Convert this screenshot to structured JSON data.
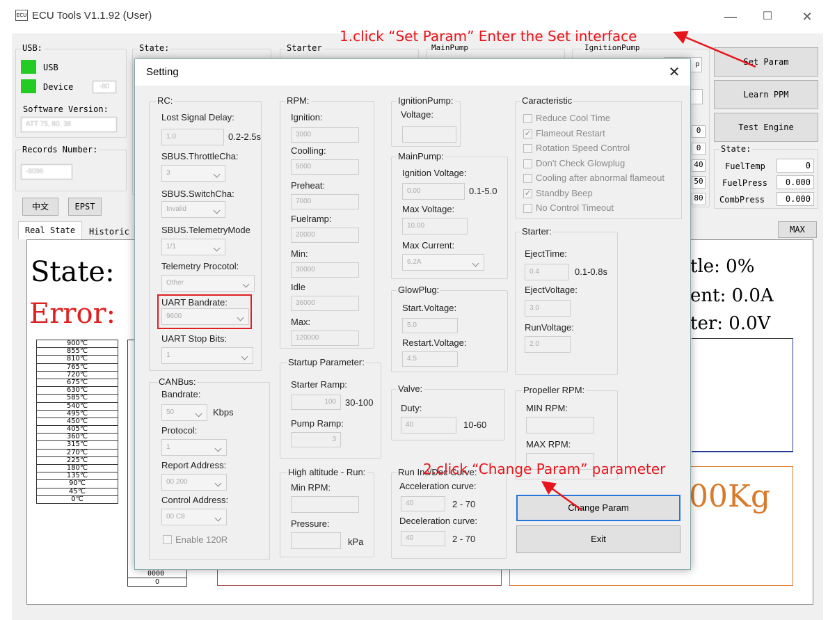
{
  "window": {
    "title": "ECU Tools V1.1.92 (User)",
    "icon": "ECU",
    "minimize": "—",
    "maximize": "☐",
    "close": "✕"
  },
  "main": {
    "usb_group": "USB:",
    "usb_label": "USB",
    "device_label": "Device",
    "device_value": "-80",
    "software_version_label": "Software Version:",
    "software_version_value": "ATT 75, 80. 38",
    "records_label": "Records Number:",
    "records_value": "-8096",
    "state_group": "State:",
    "starter_group": "Starter",
    "mainpump_group": "MainPump",
    "ignitionpump_group": "IgnitionPump",
    "lang_button": "中文",
    "epst_button": "EPST",
    "set_param": "Set Param",
    "learn_ppm": "Learn PPM",
    "test_engine": "Test Engine",
    "state_side": {
      "label": "State:",
      "rows": [
        {
          "name": "FuelTemp",
          "value": "0"
        },
        {
          "name": "FuelPress",
          "value": "0.000"
        },
        {
          "name": "CombPress",
          "value": "0.000"
        }
      ]
    },
    "tab_real": "Real State",
    "tab_historic": "Historic r",
    "max_button": "MAX",
    "state_text": "State:",
    "error_text": "Error:",
    "temps": [
      "900℃",
      "855℃",
      "810℃",
      "765℃",
      "720℃",
      "675℃",
      "630℃",
      "585℃",
      "540℃",
      "495℃",
      "450℃",
      "405℃",
      "360℃",
      "315℃",
      "270℃",
      "225℃",
      "180℃",
      "135℃",
      "90℃",
      "45℃",
      "0℃"
    ],
    "col2_values": [
      "0000",
      "0"
    ],
    "right_readouts": [
      "tle: 0%",
      "ent: 0.0A",
      "ter: 0.0V"
    ],
    "kg_text": "00Kg",
    "mini_values": [
      "0",
      "0",
      "40",
      "50",
      "80"
    ],
    "side_labels": [
      "p"
    ]
  },
  "dialog": {
    "title": "Setting",
    "close": "✕",
    "rc": {
      "group": "RC:",
      "lost_signal_delay": "Lost Signal Delay:",
      "lost_signal_value": "1.0",
      "lost_signal_range": "0.2-2.5s",
      "sbus_throttle": "SBUS.ThrottleCha:",
      "sbus_throttle_value": "3",
      "sbus_switch": "SBUS.SwitchCha:",
      "sbus_switch_value": "Invalid",
      "sbus_telemetry": "SBUS.TelemetryMode",
      "sbus_telemetry_value": "1/1",
      "telemetry_protocol": "Telemetry Procotol:",
      "telemetry_protocol_value": "Other",
      "uart_bandrate": "UART Bandrate:",
      "uart_bandrate_value": "9600",
      "uart_stop": "UART Stop Bits:",
      "uart_stop_value": "1"
    },
    "canbus": {
      "group": "CANBus:",
      "bandrate": "Bandrate:",
      "bandrate_value": "50",
      "kbps": "Kbps",
      "protocol": "Protocol:",
      "protocol_value": "1",
      "report_address": "Report Address:",
      "report_value": "00 200",
      "control_address": "Control Address:",
      "control_value": "00 C8",
      "enable120r": "Enable 120R"
    },
    "rpm": {
      "group": "RPM:",
      "ignition": "Ignition:",
      "ignition_value": "3000",
      "coolling": "Coolling:",
      "coolling_value": "5000",
      "preheat": "Preheat:",
      "preheat_value": "7000",
      "fuelramp": "Fuelramp:",
      "fuelramp_value": "20000",
      "min": "Min:",
      "min_value": "30000",
      "idle": "Idle",
      "idle_value": "36000",
      "max": "Max:",
      "max_value": "120000"
    },
    "startup": {
      "group": "Startup Parameter:",
      "starter_ramp": "Starter Ramp:",
      "starter_ramp_value": "100",
      "starter_ramp_range": "30-100",
      "pump_ramp": "Pump Ramp:",
      "pump_ramp_value": "3"
    },
    "altitude": {
      "group": "High altitude - Run:",
      "min_rpm": "Min RPM:",
      "pressure": "Pressure:",
      "kpa": "kPa"
    },
    "ignitionpump": {
      "group": "IgnitionPump:",
      "voltage": "Voltage:"
    },
    "mainpump": {
      "group": "MainPump:",
      "ignition_voltage": "Ignition Voltage:",
      "ignition_voltage_value": "0.00",
      "ignition_voltage_range": "0.1-5.0",
      "max_voltage": "Max Voltage:",
      "max_voltage_value": "10.00",
      "max_current": "Max Current:",
      "max_current_value": "6.2A"
    },
    "glowplug": {
      "group": "GlowPlug:",
      "start_voltage": "Start.Voltage:",
      "start_value": "5.0",
      "restart_voltage": "Restart.Voltage:",
      "restart_value": "4.5"
    },
    "valve": {
      "group": "Valve:",
      "duty": "Duty:",
      "duty_value": "40",
      "duty_range": "10-60"
    },
    "run_curve": {
      "group": "Run Inc/Dec Curve:",
      "acceleration": "Acceleration curve:",
      "acc_value": "40",
      "acc_range": "2 - 70",
      "deceleration": "Deceleration curve:",
      "dec_value": "40",
      "dec_range": "2 - 70"
    },
    "characteristic": {
      "group": "Caracteristic",
      "items": [
        {
          "label": "Reduce Cool Time",
          "checked": false
        },
        {
          "label": "Flameout Restart",
          "checked": true
        },
        {
          "label": "Rotation Speed Control",
          "checked": false
        },
        {
          "label": "Don't Check Glowplug",
          "checked": false
        },
        {
          "label": "Cooling after abnormal flameout",
          "checked": false
        },
        {
          "label": "Standby Beep",
          "checked": true
        },
        {
          "label": "No Control Timeout",
          "checked": false
        }
      ]
    },
    "starter": {
      "group": "Starter:",
      "eject_time": "EjectTime:",
      "eject_time_value": "0.4",
      "eject_time_range": "0.1-0.8s",
      "eject_voltage": "EjectVoltage:",
      "eject_voltage_value": "3.0",
      "run_voltage": "RunVoltage:",
      "run_voltage_value": "2.0"
    },
    "propeller": {
      "group": "Propeller RPM:",
      "min_rpm": "MIN RPM:",
      "max_rpm": "MAX RPM:"
    },
    "change_param": "Change Param",
    "exit": "Exit"
  },
  "annotations": {
    "step1": "1.click “Set Param” Enter the Set interface",
    "step2": "2.click “Change Param” parameter"
  },
  "colors": {
    "green": "#22cc22",
    "error_red": "#e02020",
    "annotation_red": "#e8141b",
    "kg_orange": "#d97a2b",
    "focus_blue": "#2677d9"
  }
}
